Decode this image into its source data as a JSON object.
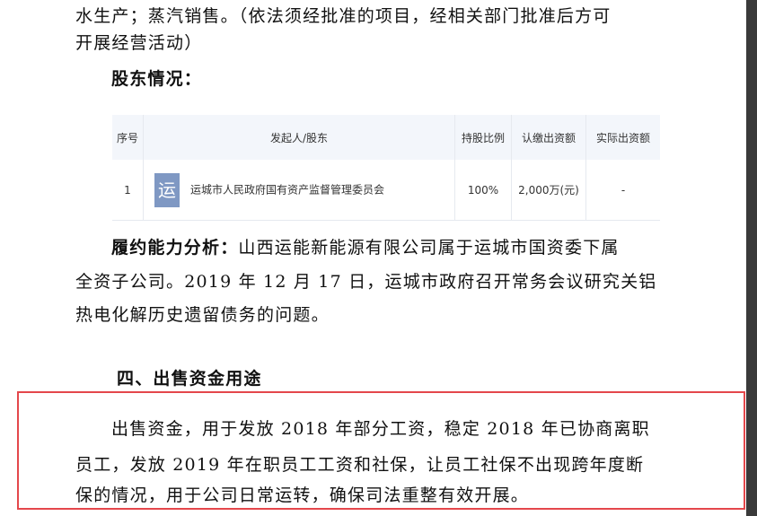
{
  "intro_lines": [
    "水生产；蒸汽销售。（依法须经批准的项目，经相关部门批准后方可",
    "开展经营活动）"
  ],
  "shareholder_heading": "股东情况：",
  "table": {
    "headers": [
      "序号",
      "发起人/股东",
      "持股比例",
      "认缴出资额",
      "实际出资额"
    ],
    "rows": [
      {
        "index": "1",
        "logo": "运",
        "name": "运城市人民政府国有资产监督管理委员会",
        "ratio": "100%",
        "subscribed": "2,000万(元)",
        "actual": "-"
      }
    ]
  },
  "analysis": {
    "label": "履约能力分析：",
    "lines": [
      "山西运能新能源有限公司属于运城市国资委下属",
      "全资子公司。2019 年 12 月 17 日，运城市政府召开常务会议研究关铝",
      "热电化解历史遗留债务的问题。"
    ]
  },
  "section4": {
    "heading": "四、出售资金用途",
    "lines": [
      "出售资金，用于发放 2018 年部分工资，稳定 2018 年已协商离职",
      "员工，发放 2019 年在职员工工资和社保，让员工社保不出现跨年度断",
      "保的情况，用于公司日常运转，确保司法重整有效开展。"
    ]
  },
  "highlight_color": "#e4474b"
}
